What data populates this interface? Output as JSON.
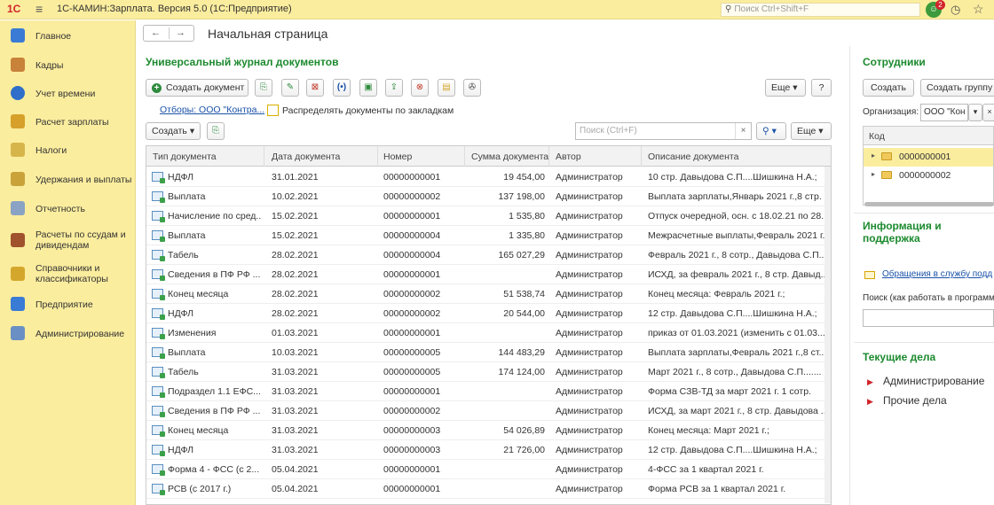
{
  "titlebar": {
    "logo": "1С",
    "title": "1С-КАМИН:Зарплата. Версия 5.0  (1С:Предприятие)",
    "search_placeholder": "Поиск Ctrl+Shift+F",
    "notifications": "2"
  },
  "sidebar": {
    "items": [
      {
        "label": "Главное",
        "icon": "home-icon",
        "color": "#3a7bd5"
      },
      {
        "label": "Кадры",
        "icon": "staff-icon",
        "color": "#c8823a"
      },
      {
        "label": "Учет времени",
        "icon": "time-icon",
        "color": "#2f6fc9"
      },
      {
        "label": "Расчет зарплаты",
        "icon": "payroll-icon",
        "color": "#d6a02a"
      },
      {
        "label": "Налоги",
        "icon": "taxes-icon",
        "color": "#d6b54a"
      },
      {
        "label": "Удержания и выплаты",
        "icon": "payments-icon",
        "color": "#c9a23a"
      },
      {
        "label": "Отчетность",
        "icon": "reports-icon",
        "color": "#8aa3c4"
      },
      {
        "label": "Расчеты по ссудам и дивидендам",
        "icon": "loans-icon",
        "color": "#a0522d"
      },
      {
        "label": "Справочники и классификаторы",
        "icon": "catalogs-icon",
        "color": "#d4a72c"
      },
      {
        "label": "Предприятие",
        "icon": "enterprise-icon",
        "color": "#3a7bd5"
      },
      {
        "label": "Администрирование",
        "icon": "admin-icon",
        "color": "#6a8fc4"
      }
    ]
  },
  "header": {
    "back": "←",
    "forward": "→",
    "title": "Начальная страница"
  },
  "journal": {
    "title": "Универсальный журнал документов",
    "create_button": "Создать документ",
    "more_button": "Еще",
    "help_button": "?",
    "filter_link": "Отборы: ООО \"Контра...",
    "distribute_label": "Распределять документы по закладкам",
    "create_dropdown": "Создать",
    "search_placeholder": "Поиск (Ctrl+F)",
    "more_button2": "Еще",
    "columns": [
      "Тип документа",
      "Дата документа",
      "Номер",
      "Сумма документа",
      "Автор",
      "Описание документа"
    ],
    "rows": [
      [
        "НДФЛ",
        "31.01.2021",
        "00000000001",
        "19 454,00",
        "Администратор",
        "10 стр. Давыдова С.П....Шишкина Н.А.;"
      ],
      [
        "Выплата",
        "10.02.2021",
        "00000000002",
        "137 198,00",
        "Администратор",
        "Выплата зарплаты,Январь 2021 г.,8 стр. ..."
      ],
      [
        "Начисление по сред...",
        "15.02.2021",
        "00000000001",
        "1 535,80",
        "Администратор",
        "Отпуск очередной, осн. с 18.02.21 по 28..."
      ],
      [
        "Выплата",
        "15.02.2021",
        "00000000004",
        "1 335,80",
        "Администратор",
        "Межрасчетные выплаты,Февраль 2021 г...."
      ],
      [
        "Табель",
        "28.02.2021",
        "00000000004",
        "165 027,29",
        "Администратор",
        "Февраль 2021 г., 8 сотр., Давыдова С.П...."
      ],
      [
        "Сведения в ПФ РФ ...",
        "28.02.2021",
        "00000000001",
        "",
        "Администратор",
        "ИСХД, за февраль 2021 г., 8 стр. Давыд..."
      ],
      [
        "Конец месяца",
        "28.02.2021",
        "00000000002",
        "51 538,74",
        "Администратор",
        "Конец месяца: Февраль 2021 г.;"
      ],
      [
        "НДФЛ",
        "28.02.2021",
        "00000000002",
        "20 544,00",
        "Администратор",
        "12 стр. Давыдова С.П....Шишкина Н.А.;"
      ],
      [
        "Изменения",
        "01.03.2021",
        "00000000001",
        "",
        "Администратор",
        " приказ  от 01.03.2021 (изменить с 01.03..."
      ],
      [
        "Выплата",
        "10.03.2021",
        "00000000005",
        "144 483,29",
        "Администратор",
        "Выплата зарплаты,Февраль 2021 г.,8 ст..."
      ],
      [
        "Табель",
        "31.03.2021",
        "00000000005",
        "174 124,00",
        "Администратор",
        "Март 2021 г., 8 сотр., Давыдова С.П......."
      ],
      [
        "Подраздел 1.1 ЕФС...",
        "31.03.2021",
        "00000000001",
        "",
        "Администратор",
        "Форма СЗВ-ТД за март 2021 г. 1 сотр."
      ],
      [
        "Сведения в ПФ РФ ...",
        "31.03.2021",
        "00000000002",
        "",
        "Администратор",
        "ИСХД, за март 2021 г., 8 стр. Давыдова ..."
      ],
      [
        "Конец месяца",
        "31.03.2021",
        "00000000003",
        "54 026,89",
        "Администратор",
        "Конец месяца: Март 2021 г.;"
      ],
      [
        "НДФЛ",
        "31.03.2021",
        "00000000003",
        "21 726,00",
        "Администратор",
        "12 стр. Давыдова С.П....Шишкина Н.А.;"
      ],
      [
        "Форма 4 - ФСС (с 2...",
        "05.04.2021",
        "00000000001",
        "",
        "Администратор",
        "4-ФСС за 1 квартал 2021 г."
      ],
      [
        "РСВ (с 2017 г.)",
        "05.04.2021",
        "00000000001",
        "",
        "Администратор",
        "Форма РСВ за 1 квартал 2021 г."
      ]
    ]
  },
  "employees": {
    "title": "Сотрудники",
    "create_button": "Создать",
    "create_group_button": "Создать группу",
    "org_label": "Организация:",
    "org_value": "ООО \"Кон",
    "code_header": "Код",
    "rows": [
      "0000000001",
      "0000000002"
    ]
  },
  "support": {
    "title": "Информация и поддержка",
    "link": "Обращения в службу подд",
    "search_label": "Поиск (как работать в программе"
  },
  "tasks": {
    "title": "Текущие дела",
    "items": [
      "Администрирование",
      "Прочие дела"
    ]
  },
  "colors": {
    "accent_green": "#1c8a2e",
    "panel_yellow": "#fbed9e",
    "link_blue": "#1a52a8"
  }
}
